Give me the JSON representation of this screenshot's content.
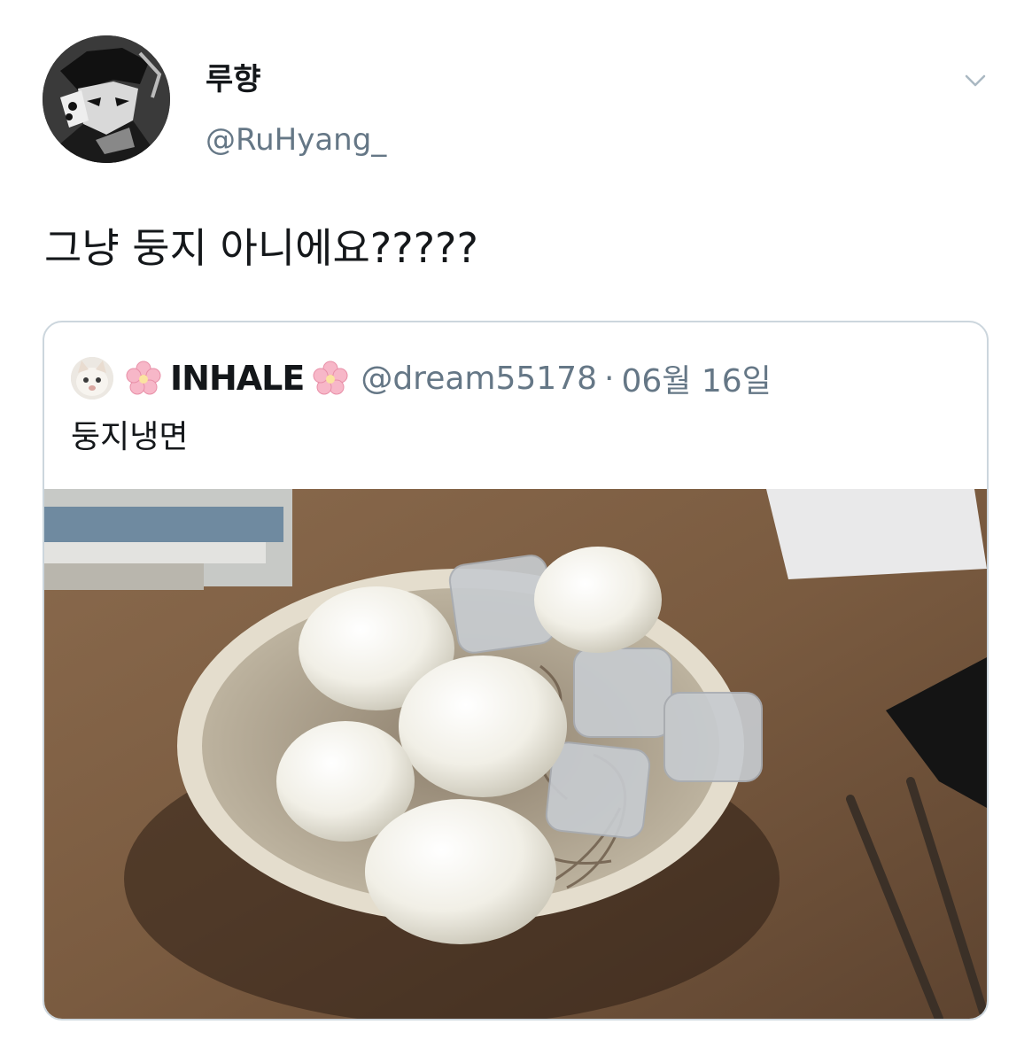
{
  "tweet": {
    "display_name": "루향",
    "handle": "@RuHyang_",
    "text": "그냥 둥지 아니에요?????",
    "avatar_icon": "manga-character-avatar",
    "menu_icon": "chevron-down-icon"
  },
  "quote": {
    "display_name": "INHALE",
    "name_decoration_icon": "cherry-blossom-icon",
    "handle": "@dream55178",
    "separator": "·",
    "date": "06월 16일",
    "text": "둥지냉면",
    "avatar_icon": "cat-avatar",
    "photo": "bowl of cold noodles topped with boiled eggs and ice cubes"
  },
  "colors": {
    "primary_text": "#14171a",
    "secondary_text": "#657786",
    "border": "#ccd6dd"
  }
}
